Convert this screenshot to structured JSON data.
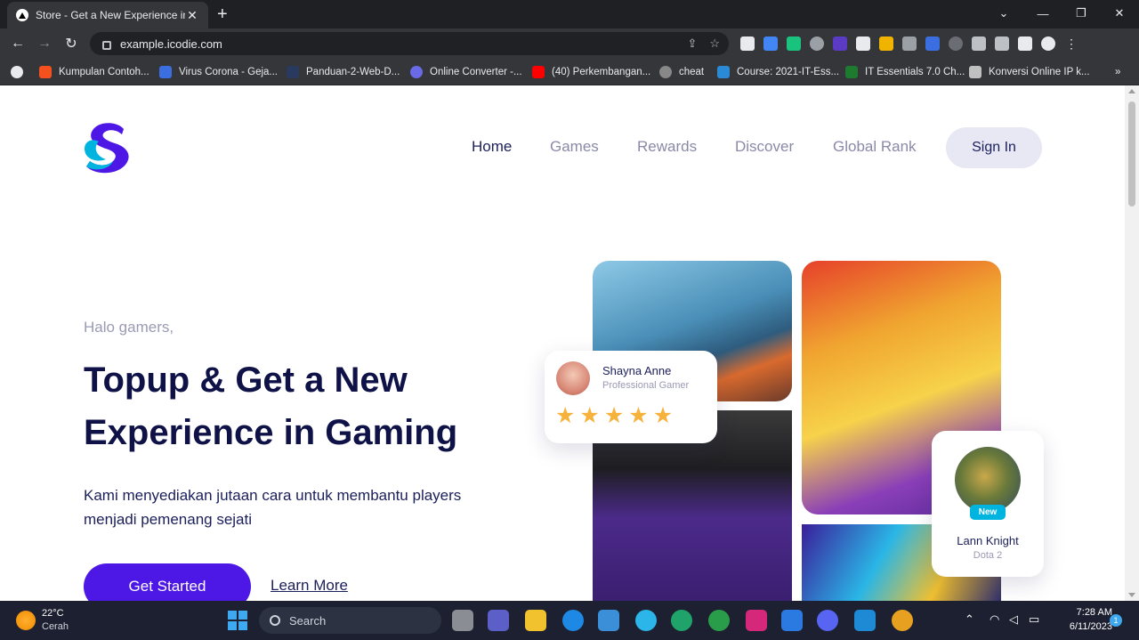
{
  "browser": {
    "tab_title": "Store - Get a New Experience in G",
    "new_tab": "+",
    "url": "example.icodie.com",
    "window_controls": {
      "minimize": "—",
      "restore": "❐",
      "close": "✕"
    },
    "tab_dropdown": "⌄",
    "bookmarks": [
      {
        "label": "Kumpulan Contoh...",
        "color": "#f4511e"
      },
      {
        "label": "Virus Corona - Geja...",
        "color": "#3b6ee0"
      },
      {
        "label": "Panduan-2-Web-D...",
        "color": "#2a3a5e"
      },
      {
        "label": "Online Converter -...",
        "color": "#6a6ae6"
      },
      {
        "label": "(40) Perkembangan...",
        "color": "#ff0000"
      },
      {
        "label": "cheat",
        "color": "#888888"
      },
      {
        "label": "Course: 2021-IT-Ess...",
        "color": "#2a8ad6"
      },
      {
        "label": "IT Essentials 7.0 Ch...",
        "color": "#1e7a2e"
      },
      {
        "label": "Konversi Online IP k...",
        "color": "#c0c0c0"
      }
    ],
    "bookmarks_more": "»"
  },
  "site": {
    "nav": [
      {
        "label": "Home",
        "active": true
      },
      {
        "label": "Games",
        "active": false
      },
      {
        "label": "Rewards",
        "active": false
      },
      {
        "label": "Discover",
        "active": false
      },
      {
        "label": "Global Rank",
        "active": false
      }
    ],
    "sign_in": "Sign In",
    "hero": {
      "greeting": "Halo gamers,",
      "headline_part1": "Topup & Get a",
      "headline_highlight1": "New",
      "headline_highlight2": "Experience",
      "headline_part2": "in Gaming",
      "subtext": "Kami menyediakan jutaan cara untuk membantu players menjadi pemenang sejati",
      "cta": "Get Started",
      "learn_more": "Learn More"
    },
    "gamer_card": {
      "name": "Shayna Anne",
      "role": "Professional Gamer",
      "rating": 5,
      "star_glyph": "★"
    },
    "hero_card": {
      "badge": "New",
      "name": "Lann Knight",
      "game": "Dota 2"
    },
    "colors": {
      "primary": "#4d17e6",
      "accent": "#00b4e0",
      "heading": "#0f1247",
      "muted": "#9a9ab4"
    }
  },
  "taskbar": {
    "weather_temp": "22°C",
    "weather_desc": "Cerah",
    "search_label": "Search",
    "time": "7:28 AM",
    "date": "6/11/2023",
    "notification_count": "1"
  }
}
